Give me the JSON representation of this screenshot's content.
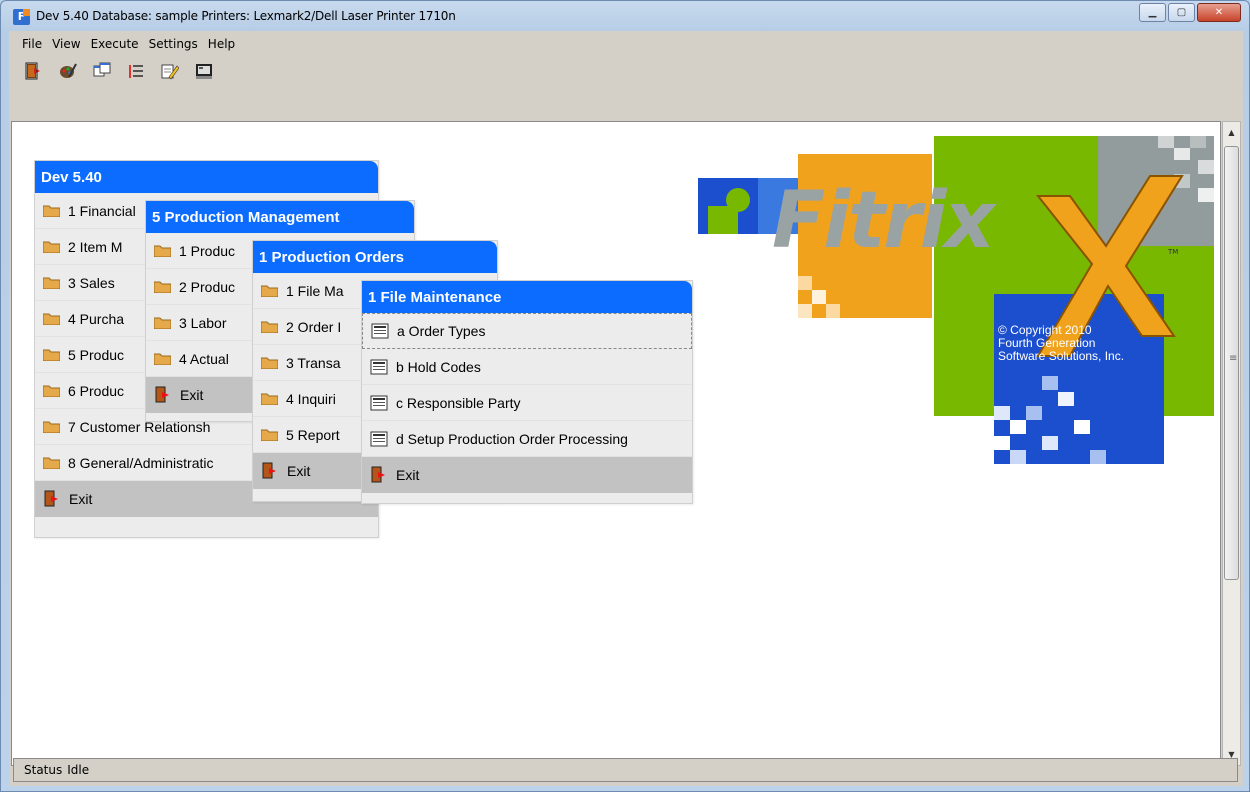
{
  "window": {
    "title": "Dev 5.40 Database: sample Printers: Lexmark2/Dell Laser Printer 1710n",
    "app_icon_letter": "F"
  },
  "menubar": [
    "File",
    "View",
    "Execute",
    "Settings",
    "Help"
  ],
  "toolbar_icons": [
    "exit-icon",
    "paint-icon",
    "windows-icon",
    "list-icon",
    "edit-icon",
    "screen-icon"
  ],
  "menu_main": {
    "title": "Dev 5.40",
    "items": [
      "1 Financial",
      "2 Item M",
      "3 Sales",
      "4 Purcha",
      "5 Produc",
      "6 Produc",
      "7 Customer Relationsh",
      "8 General/Administratic"
    ],
    "exit": "Exit"
  },
  "menu_production": {
    "title": "5 Production Management",
    "items": [
      "1 Produc",
      "2 Produc",
      "3 Labor",
      "4 Actual"
    ],
    "exit": "Exit"
  },
  "menu_orders": {
    "title": "1 Production Orders",
    "items": [
      "1 File Ma",
      "2 Order I",
      "3 Transa",
      "4 Inquiri",
      "5 Report"
    ],
    "exit": "Exit"
  },
  "menu_file": {
    "title": "1 File Maintenance",
    "items": [
      "a Order Types",
      "b Hold Codes",
      "c Responsible Party",
      "d Setup Production Order Processing"
    ],
    "exit": "Exit"
  },
  "logo": {
    "text": "Fitrix",
    "tm": "TM",
    "copyright_lines": [
      "© Copyright 2010",
      "Fourth Generation",
      "Software Solutions, Inc."
    ],
    "colors": {
      "green": "#78b800",
      "orange": "#f0a21c",
      "blue": "#1c4fce",
      "gray": "#9aa3a4"
    }
  },
  "status": {
    "label": "Status",
    "value": "Idle"
  }
}
